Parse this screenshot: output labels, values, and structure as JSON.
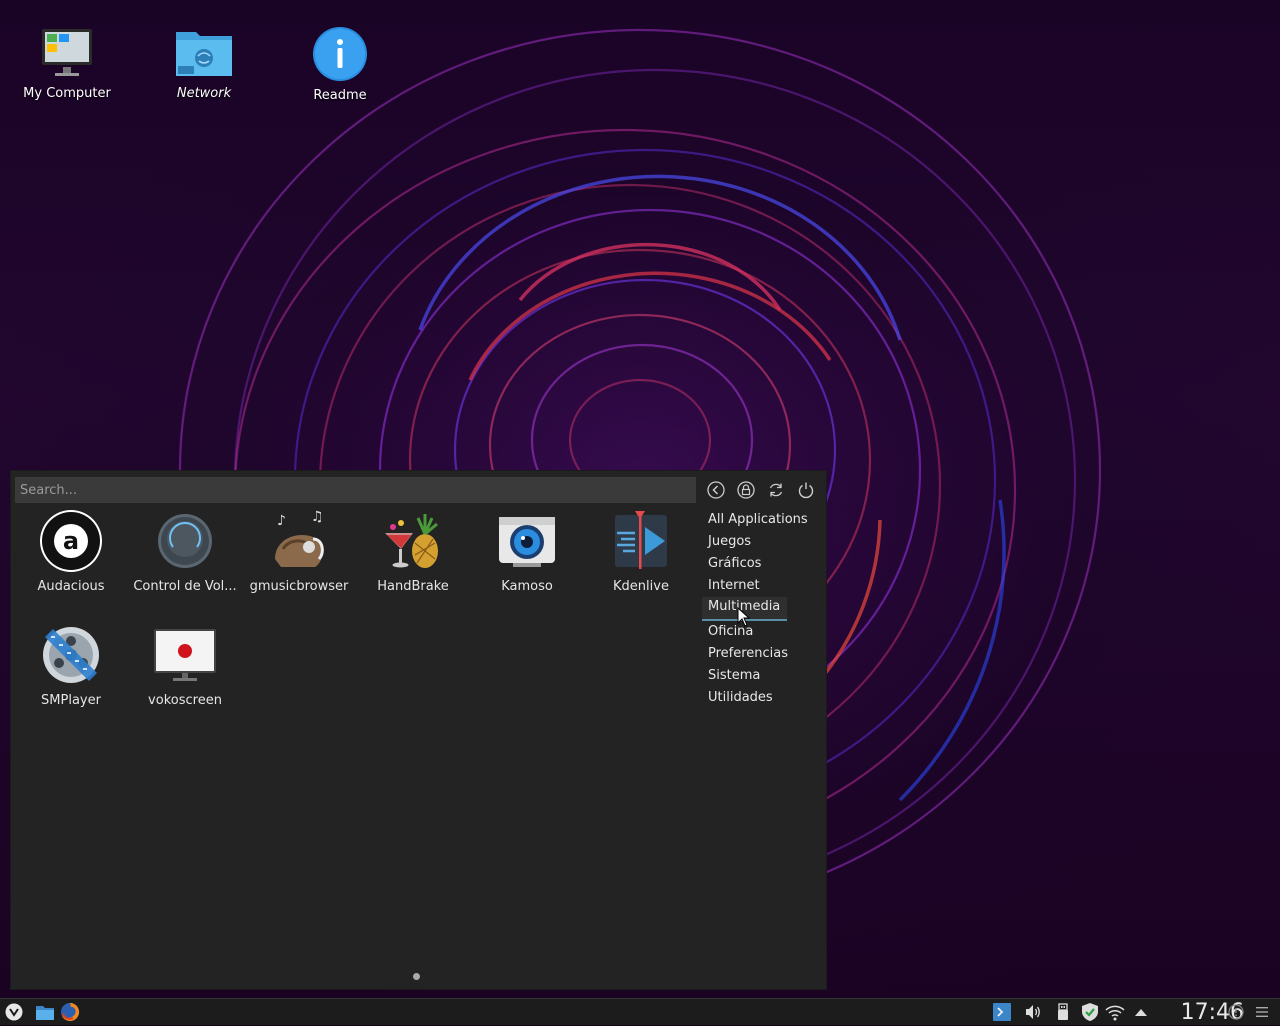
{
  "desktop": {
    "icons": [
      {
        "label": "My Computer",
        "icon": "computer-icon"
      },
      {
        "label": "Network",
        "icon": "network-folder-icon"
      },
      {
        "label": "Readme",
        "icon": "info-icon"
      }
    ]
  },
  "launcher": {
    "search_placeholder": "Search...",
    "actions": [
      "back-icon",
      "lock-icon",
      "refresh-icon",
      "power-icon"
    ],
    "categories": [
      {
        "label": "All Applications"
      },
      {
        "label": "Juegos"
      },
      {
        "label": "Gráficos"
      },
      {
        "label": "Internet"
      },
      {
        "label": "Multimedia",
        "active": true
      },
      {
        "label": "Oficina"
      },
      {
        "label": "Preferencias"
      },
      {
        "label": "Sistema"
      },
      {
        "label": "Utilidades"
      }
    ],
    "apps": [
      {
        "label": "Audacious",
        "icon": "audacious-icon"
      },
      {
        "label": "Control de Vol...",
        "icon": "volume-knob-icon"
      },
      {
        "label": "gmusicbrowser",
        "icon": "gmusicbrowser-icon"
      },
      {
        "label": "HandBrake",
        "icon": "handbrake-icon"
      },
      {
        "label": "Kamoso",
        "icon": "webcam-icon"
      },
      {
        "label": "Kdenlive",
        "icon": "kdenlive-icon"
      },
      {
        "label": "SMPlayer",
        "icon": "smplayer-icon"
      },
      {
        "label": "vokoscreen",
        "icon": "vokoscreen-icon"
      }
    ]
  },
  "taskbar": {
    "clock": "17:46",
    "launchers": [
      "menu-icon",
      "file-manager-icon",
      "firefox-icon"
    ],
    "tray": [
      "terminal-icon",
      "speaker-icon",
      "usb-icon",
      "shield-check-icon",
      "wifi-icon",
      "arrow-up-icon"
    ],
    "accent": "#3a86c8"
  }
}
